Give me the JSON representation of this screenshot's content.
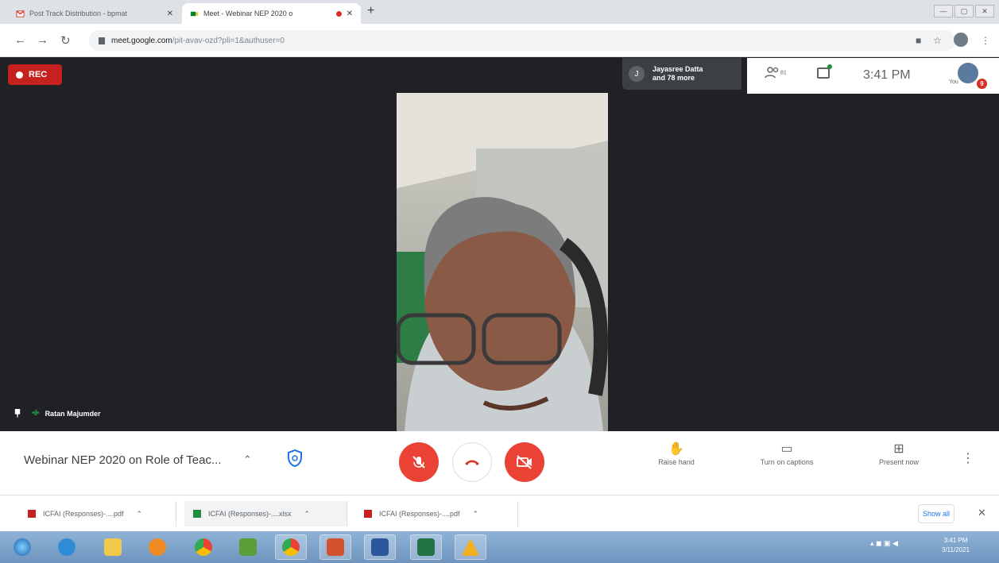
{
  "browser": {
    "tabs": [
      {
        "title": "Post Track Distribution - bpmat",
        "close": "✕",
        "active": false
      },
      {
        "title": "Meet - Webinar NEP 2020 o",
        "close": "✕",
        "active": true
      }
    ],
    "new_tab": "+",
    "address": {
      "host": "meet.google.com",
      "path": "/pit-avav-ozd?pli=1&authuser=0"
    }
  },
  "meet": {
    "rec_label": "REC",
    "participants": {
      "initial": "J",
      "line1": "Jayasree Datta",
      "line2": "and 78 more"
    },
    "people_count": "81",
    "clock": "3:41 PM",
    "you_label": "You",
    "notification_count": "9",
    "speaker_name": "Ratan Majumder",
    "meeting_title": "Webinar NEP 2020 on Role of Teac...",
    "actions": {
      "raise_hand": "Raise hand",
      "captions": "Turn on captions",
      "present": "Present now"
    }
  },
  "downloads": {
    "items": [
      {
        "name": "ICFAI (Responses)-....pdf"
      },
      {
        "name": "ICFAI (Responses)-....xlsx"
      },
      {
        "name": "ICFAI (Responses)-....pdf"
      }
    ],
    "show_all": "Show all"
  },
  "taskbar": {
    "time": "3:41 PM",
    "date": "3/11/2021"
  },
  "colors": {
    "meet_red": "#ea4335",
    "stage_bg": "#202124",
    "accent_blue": "#1a73e8"
  }
}
